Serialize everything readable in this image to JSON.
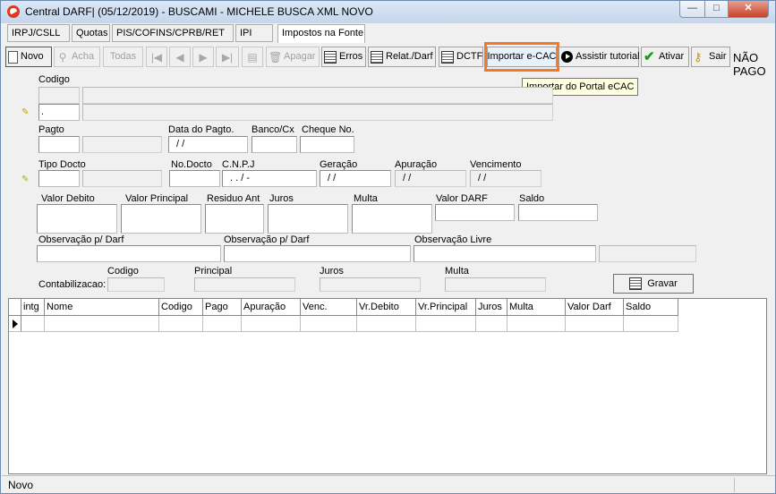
{
  "window": {
    "title": "Central DARF| (05/12/2019) - BUSCAMI - MICHELE BUSCA XML NOVO",
    "min": "—",
    "max": "□",
    "close": "✕"
  },
  "tabs": [
    "IRPJ/CSLL",
    "Quotas",
    "PIS/COFINS/CPRB/RET",
    "IPI",
    "Impostos na Fonte"
  ],
  "toolbar": {
    "novo": "Novo",
    "acha": "Acha",
    "todas": "Todas",
    "apagar": "Apagar",
    "erros": "Erros",
    "relat": "Relat./Darf",
    "dctf": "DCTF",
    "importar": "Importar e-CAC",
    "tutorial": "Assistir tutorial",
    "ativar": "Ativar",
    "sair": "Sair"
  },
  "tooltip": "Importar do Portal eCAC",
  "status_flag": {
    "line1": "NÃO",
    "line2": "PAGO"
  },
  "form": {
    "codigo_label": "Codigo",
    "codigo_value": ".",
    "pagto_label": "Pagto",
    "data_pagto_label": "Data do Pagto.",
    "data_pagto_value": "/ /",
    "banco_label": "Banco/Cx",
    "cheque_label": "Cheque No.",
    "tipo_docto_label": "Tipo Docto",
    "no_docto_label": "No.Docto",
    "cnpj_label": "C.N.P.J",
    "cnpj_value": ". .   /   -",
    "geracao_label": "Geração",
    "geracao_value": "/ /",
    "apuracao_label": "Apuração",
    "apuracao_value": "/ /",
    "vencimento_label": "Vencimento",
    "vencimento_value": "/ /",
    "valor_debito_label": "Valor Debito",
    "valor_principal_label": "Valor Principal",
    "residuo_label": "Residuo Ant",
    "juros_label": "Juros",
    "multa_label": "Multa",
    "valor_darf_label": "Valor DARF",
    "saldo_label": "Saldo",
    "obs1_label": "Observação p/ Darf",
    "obs2_label": "Observação p/ Darf",
    "obs_livre_label": "Observação Livre",
    "contab_label": "Contabilizacao:",
    "contab_codigo": "Codigo",
    "contab_principal": "Principal",
    "contab_juros": "Juros",
    "contab_multa": "Multa",
    "gravar": "Gravar"
  },
  "grid": {
    "columns": [
      "intg",
      "Nome",
      "Codigo",
      "Pago",
      "Apuração",
      "Venc.",
      "Vr.Debito",
      "Vr.Principal",
      "Juros",
      "Multa",
      "Valor Darf",
      "Saldo"
    ]
  },
  "statusbar": {
    "text": "Novo"
  }
}
